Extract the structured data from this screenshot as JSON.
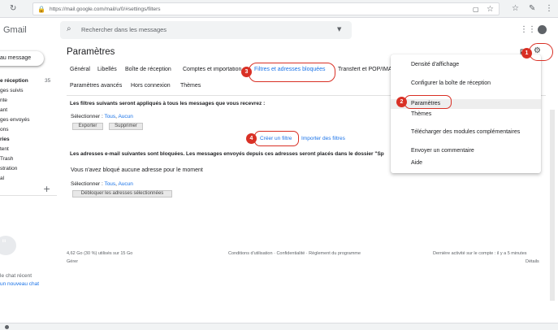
{
  "browser": {
    "url": "https://mail.google.com/mail/u/0/#settings/filters"
  },
  "header": {
    "logo": "Gmail",
    "search_placeholder": "Rechercher dans les messages"
  },
  "sidebar": {
    "compose_label": "au message",
    "inbox": "e réception",
    "inbox_count": "35",
    "items": [
      "ges suivis",
      "nte",
      "ant",
      "ges envoyés",
      "ons",
      "ries",
      "tent",
      "Trash",
      "stration",
      "al"
    ],
    "chat_line1": "le chat récent",
    "chat_link": "un nouveau chat"
  },
  "main": {
    "title": "Paramètres",
    "tabs": [
      "Général",
      "Libellés",
      "Boîte de réception",
      "Comptes et importation",
      "Filtres et adresses bloquées",
      "Transfert et POP/IMAP"
    ],
    "tabs_row2": [
      "Paramètres avancés",
      "Hors connexion",
      "Thèmes"
    ],
    "filters_heading": "Les filtres suivants seront appliqués à tous les messages que vous recevrez :",
    "select_label": "Sélectionner : ",
    "select_all": "Tous",
    "select_none": "Aucun",
    "export_btn": "Exporter",
    "delete_btn": "Supprimer",
    "create_filter": "Créer un filtre",
    "import_filters": "Importer des filtres",
    "blocked_heading": "Les adresses e-mail suivantes sont bloquées. Les messages envoyés depuis ces adresses seront placés dans le dossier \"Sp",
    "no_blocked": "Vous n'avez bloqué aucune adresse pour le moment",
    "unblock_btn": "Débloquer les adresses sélectionnées"
  },
  "footer": {
    "storage": "4,62 Go (30 %) utilisés sur 15 Go",
    "manage": "Gérer",
    "links": "Conditions d'utilisation · Confidentialité · Règlement du programme",
    "activity": "Dernière activité sur le compte : il y a 5 minutes",
    "details": "Détails"
  },
  "menu": {
    "items": [
      "Densité d'affichage",
      "Configurer la boîte de réception",
      "Paramètres",
      "Thèmes",
      "Télécharger des modules complémentaires",
      "Envoyer un commentaire",
      "Aide"
    ]
  },
  "callouts": [
    "1",
    "2",
    "3",
    "4"
  ],
  "colors": {
    "callout": "#d93025",
    "link": "#1a73e8"
  }
}
